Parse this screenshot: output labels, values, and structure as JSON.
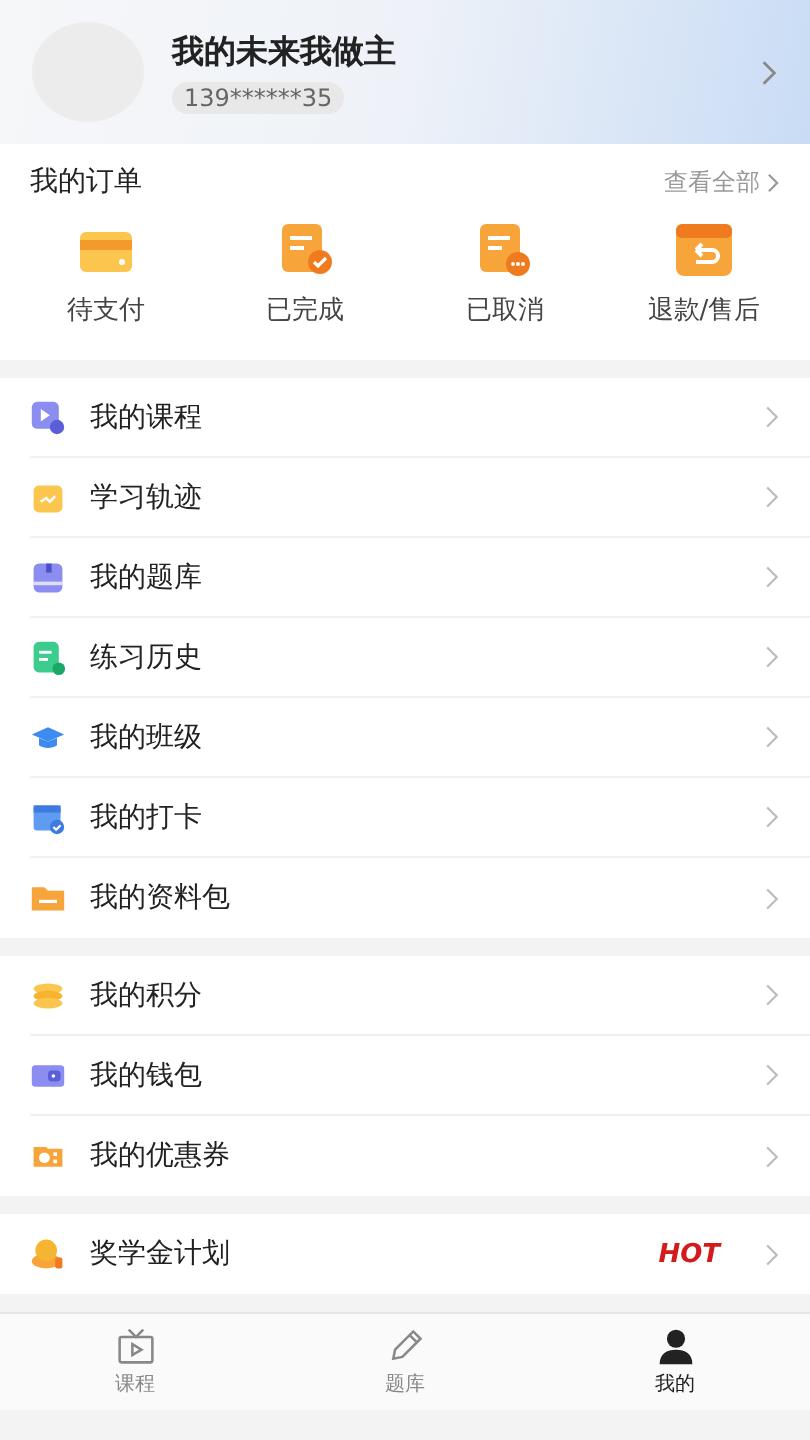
{
  "profile": {
    "name": "我的未来我做主",
    "phone": "139******35"
  },
  "orders": {
    "title": "我的订单",
    "view_all": "查看全部",
    "items": [
      {
        "label": "待支付"
      },
      {
        "label": "已完成"
      },
      {
        "label": "已取消"
      },
      {
        "label": "退款/售后"
      }
    ]
  },
  "menu_groups": [
    [
      {
        "label": "我的课程"
      },
      {
        "label": "学习轨迹"
      },
      {
        "label": "我的题库"
      },
      {
        "label": "练习历史"
      },
      {
        "label": "我的班级"
      },
      {
        "label": "我的打卡"
      },
      {
        "label": "我的资料包"
      }
    ],
    [
      {
        "label": "我的积分"
      },
      {
        "label": "我的钱包"
      },
      {
        "label": "我的优惠券"
      }
    ],
    [
      {
        "label": "奖学金计划",
        "badge": "HOT"
      }
    ]
  ],
  "tabs": [
    {
      "label": "课程",
      "selected": false
    },
    {
      "label": "题库",
      "selected": false
    },
    {
      "label": "我的",
      "selected": true
    }
  ]
}
